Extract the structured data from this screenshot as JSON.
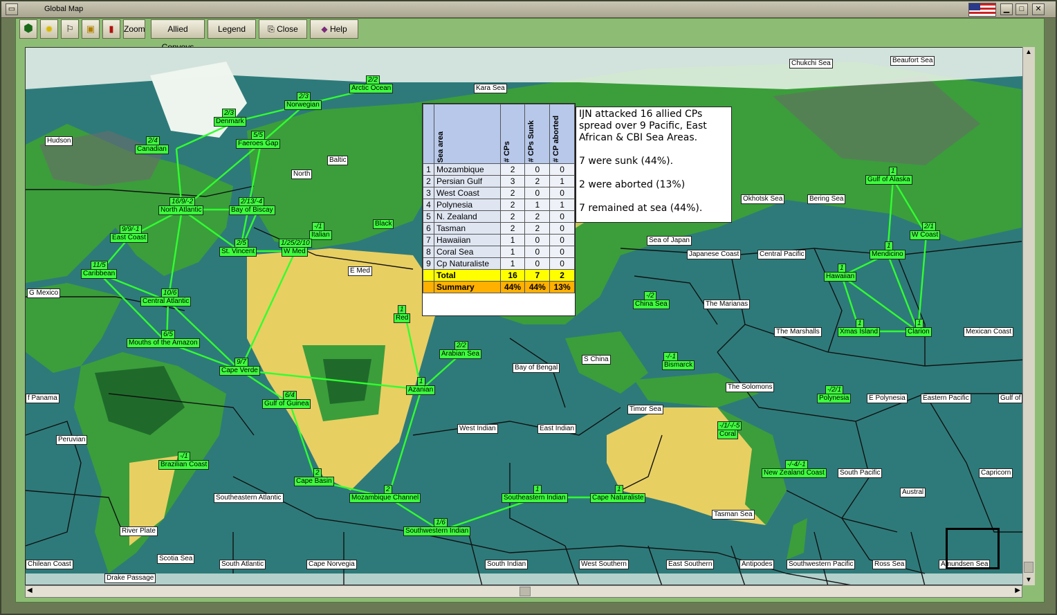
{
  "window": {
    "title": "Global Map"
  },
  "toolbar": {
    "zoom": "Zoom",
    "allied_convoys": "Allied Convoys",
    "legend": "Legend",
    "close": "Close",
    "help": "Help"
  },
  "stats": {
    "headers": {
      "area": "Sea area",
      "cps": "# CPs",
      "sunk": "# CPs Sunk",
      "aborted": "# CP aborted"
    },
    "rows": [
      {
        "i": "1",
        "area": "Mozambique",
        "cps": "2",
        "sunk": "0",
        "aborted": "0"
      },
      {
        "i": "2",
        "area": "Persian Gulf",
        "cps": "3",
        "sunk": "2",
        "aborted": "1"
      },
      {
        "i": "3",
        "area": "West Coast",
        "cps": "2",
        "sunk": "0",
        "aborted": "0"
      },
      {
        "i": "4",
        "area": "Polynesia",
        "cps": "2",
        "sunk": "1",
        "aborted": "1"
      },
      {
        "i": "5",
        "area": "N. Zealand",
        "cps": "2",
        "sunk": "2",
        "aborted": "0"
      },
      {
        "i": "6",
        "area": "Tasman",
        "cps": "2",
        "sunk": "2",
        "aborted": "0"
      },
      {
        "i": "7",
        "area": "Hawaiian",
        "cps": "1",
        "sunk": "0",
        "aborted": "0"
      },
      {
        "i": "8",
        "area": "Coral Sea",
        "cps": "1",
        "sunk": "0",
        "aborted": "0"
      },
      {
        "i": "9",
        "area": "Cp Naturaliste",
        "cps": "1",
        "sunk": "0",
        "aborted": "0"
      }
    ],
    "total": {
      "label": "Total",
      "cps": "16",
      "sunk": "7",
      "aborted": "2"
    },
    "summary": {
      "label": "Summary",
      "cps": "44%",
      "sunk": "44%",
      "aborted": "13%"
    }
  },
  "note": {
    "line1": "IJN attacked 16 allied CPs spread over 9 Pacific, East African & CBI Sea Areas.",
    "line2": "7 were sunk (44%).",
    "line3": "2 were aborted (13%)",
    "line4": "7 remained at sea (44%)."
  },
  "white_labels": [
    "Chukchi Sea",
    "Beaufort Sea",
    "Kara Sea",
    "Hudson",
    "Baltic",
    "North",
    "E Med",
    "G Mexico",
    "Okhotsk Sea",
    "Bering Sea",
    "Sea of Japan",
    "Japanese Coast",
    "Central Pacific",
    "The Marianas",
    "The Marshalls",
    "Mexican Coast",
    "S China",
    "Bay of Bengal",
    "The Solomons",
    "E Polynesia",
    "Eastern Pacific",
    "Gulf of",
    "f Panama",
    "Timor Sea",
    "West Indian",
    "East Indian",
    "Peruvian",
    "South Pacific",
    "Capricorn",
    "Austral",
    "Southeastern Atlantic",
    "Tasman Sea",
    "River Plate",
    "Scotia Sea",
    "Chilean Coast",
    "South Atlantic",
    "Cape Norvegia",
    "South Indian",
    "West Southern",
    "East Southern",
    "Antipodes",
    "Southwestern Pacific",
    "Ross Sea",
    "Amundsen Sea",
    "Drake Passage"
  ],
  "green_labels": [
    "Arctic Ocean",
    "Norwegian",
    "Denmark",
    "Faeroes Gap",
    "Canadian",
    "North Atlantic",
    "Bay of Biscay",
    "Black",
    "Italian",
    "St. Vincent",
    "W Med",
    "East Coast",
    "Caribbean",
    "Central Atlantic",
    "Mouths of the Amazon",
    "Cape Verde",
    "Red",
    "Arabian Sea",
    "Azanian",
    "Gulf of Guinea",
    "Cape Basin",
    "Mozambique Channel",
    "Southwestern Indian",
    "Southeastern Indian",
    "Cape Naturaliste",
    "China Sea",
    "Bismarck",
    "Coral",
    "New Zealand Coast",
    "Polynesia",
    "Xmas Island",
    "Clarion",
    "Hawaiian",
    "Mendicino",
    "W Coast",
    "Gulf of Alaska",
    "Brazilian Coast"
  ],
  "counts": [
    "2/2",
    "2/3",
    "2/3",
    "5/5",
    "2/4",
    "16/9/-2",
    "2/13/-4",
    "-/1",
    "9/9/-1",
    "2/5",
    "1/25/2/10",
    "11/5",
    "10/6",
    "6/5",
    "9/7",
    "6/4",
    "2",
    "2",
    "1/6",
    "1",
    "1",
    "1",
    "2/2",
    "1",
    "-/2",
    "-/-1",
    "-/1/-/-5",
    "-/-4/-1",
    "-/2/1",
    "1",
    "1",
    "1",
    "1",
    "2/1",
    "1",
    "-/1"
  ]
}
